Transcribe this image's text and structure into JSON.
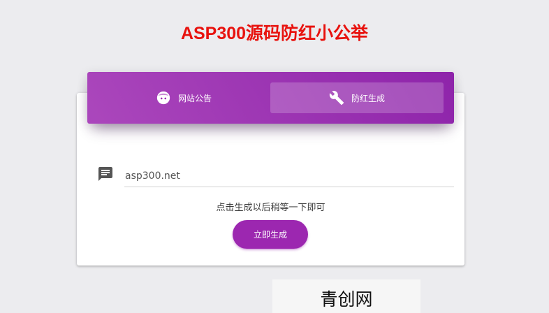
{
  "page": {
    "title": "ASP300源码防红小公举",
    "title_color": "#e8120e"
  },
  "tabs": [
    {
      "label": "网站公告",
      "icon": "face-icon",
      "active": false
    },
    {
      "label": "防红生成",
      "icon": "wrench-icon",
      "active": true
    }
  ],
  "form": {
    "field_icon": "message-icon",
    "url_value": "asp300.net",
    "hint": "点击生成以后稍等一下即可",
    "submit_label": "立即生成"
  },
  "footer": {
    "badge_text": "青创网"
  },
  "colors": {
    "accent": "#9c27b0",
    "tab_gradient_start": "#ab47bc",
    "tab_gradient_end": "#8e24aa",
    "background": "#ececef"
  }
}
